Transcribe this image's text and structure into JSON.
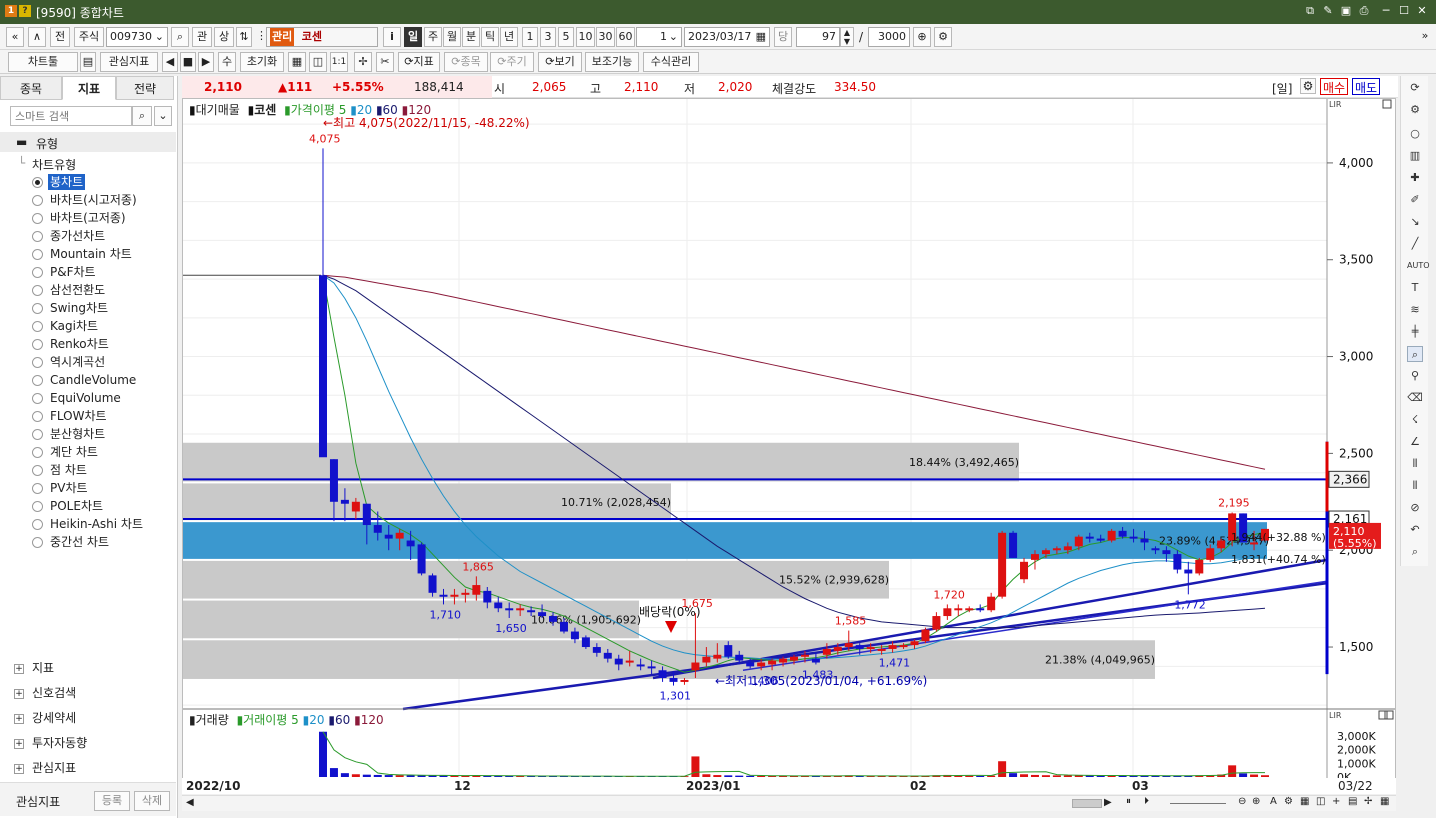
{
  "window": {
    "title": "[9590] 종합차트",
    "logo1": "1",
    "logo2": "?",
    "min": "─",
    "max": "☐",
    "close": "✕"
  },
  "toolbar1": {
    "nav_first": "«",
    "nav_prev": "∧",
    "prev_label": "전",
    "market": "주식",
    "code": "009730",
    "search_icon": "⌕",
    "lbl_gwan": "관",
    "lbl_sang": "상",
    "stock_badge": "관리",
    "stock_name": "코센",
    "info": "i",
    "periods": [
      "일",
      "주",
      "월",
      "분",
      "틱",
      "년"
    ],
    "period_selected": "일",
    "intervals": [
      "1",
      "3",
      "5",
      "10",
      "30",
      "60"
    ],
    "interval_value": "1",
    "date": "2023/03/17",
    "dang": "당",
    "count": "97",
    "slash": "/",
    "total": "3000"
  },
  "toolbar2": {
    "chart_tool": "차트툴",
    "fav_indicator": "관심지표",
    "su": "수",
    "reset": "초기화",
    "onetoone": "1:1",
    "indicator": "지표",
    "item": "종목",
    "cycle": "주기",
    "view": "보기",
    "aux": "보조기능",
    "formula": "수식관리"
  },
  "left_panel": {
    "tabs": [
      "종목",
      "지표",
      "전략"
    ],
    "selected_tab": "지표",
    "search_placeholder": "스마트 검색",
    "section": "유형",
    "group": "차트유형",
    "chart_types": [
      "봉차트",
      "바차트(시고저종)",
      "바차트(고저종)",
      "종가선차트",
      "Mountain 차트",
      "P&F차트",
      "삼선전환도",
      "Swing차트",
      "Kagi차트",
      "Renko차트",
      "역시계곡선",
      "CandleVolume",
      "EquiVolume",
      "FLOW차트",
      "분산형차트",
      "계단 차트",
      "점 차트",
      "PV차트",
      "POLE차트",
      "Heikin-Ashi 차트",
      "중간선 차트"
    ],
    "selected_type": "봉차트",
    "bottom_items": [
      "지표",
      "신호검색",
      "강세약세",
      "투자자동향",
      "관심지표"
    ],
    "footer_label": "관심지표",
    "register": "등록",
    "delete": "삭제"
  },
  "quote": {
    "price": "2,110",
    "change": "▲111",
    "change_pct": "+5.55%",
    "volume": "188,414",
    "open_label": "시",
    "open": "2,065",
    "high_label": "고",
    "high": "2,110",
    "low_label": "저",
    "low": "2,020",
    "strength_label": "체결강도",
    "strength": "334.50",
    "period_tag": "[일]",
    "buy": "매수",
    "sell": "매도"
  },
  "legend_main": {
    "vol_profile": "대기매물",
    "name": "코센",
    "ma_label": "가격이평",
    "ma": [
      "5",
      "20",
      "60",
      "120"
    ]
  },
  "legend_vol": {
    "title": "거래량",
    "ma_label": "거래이평",
    "ma": [
      "5",
      "20",
      "60",
      "120"
    ]
  },
  "annotations": {
    "high": "←최고 4,075(2022/11/15, -48.22%)",
    "low": "←최저 1,305(2023/01/04, +61.69%)",
    "dividend": "배당락(0%)"
  },
  "y_axis": {
    "ticks": [
      "4,000",
      "3,500",
      "3,000",
      "2,500",
      "2,000",
      "1,500"
    ],
    "marker_upper": "2,366",
    "marker_mid": "2,161",
    "marker_price": "2,110",
    "marker_pct": "(5.55%)"
  },
  "vol_axis": {
    "ticks": [
      "3,000K",
      "2,000K",
      "1,000K",
      "0K"
    ]
  },
  "x_axis": {
    "labels": [
      "2022/10",
      "12",
      "2023/01",
      "02",
      "03"
    ],
    "end": "03/22"
  },
  "chart_data": {
    "type": "candlestick",
    "title": "코센",
    "ylim": [
      1180,
      4330
    ],
    "candles": [
      [
        3420,
        4075,
        3420,
        2480
      ],
      [
        2470,
        2470,
        2150,
        2250
      ],
      [
        2260,
        2320,
        2150,
        2240
      ],
      [
        2200,
        2270,
        2160,
        2250
      ],
      [
        2240,
        2240,
        2030,
        2130
      ],
      [
        2130,
        2200,
        2050,
        2090
      ],
      [
        2080,
        2130,
        2000,
        2060
      ],
      [
        2060,
        2110,
        2000,
        2090
      ],
      [
        2050,
        2100,
        1950,
        2020
      ],
      [
        2030,
        2040,
        1870,
        1880
      ],
      [
        1870,
        1880,
        1760,
        1780
      ],
      [
        1770,
        1800,
        1720,
        1760
      ],
      [
        1760,
        1800,
        1720,
        1770
      ],
      [
        1770,
        1800,
        1730,
        1780
      ],
      [
        1770,
        1865,
        1740,
        1820
      ],
      [
        1790,
        1810,
        1700,
        1730
      ],
      [
        1730,
        1760,
        1680,
        1700
      ],
      [
        1700,
        1730,
        1650,
        1690
      ],
      [
        1690,
        1720,
        1660,
        1700
      ],
      [
        1690,
        1710,
        1660,
        1680
      ],
      [
        1680,
        1720,
        1650,
        1660
      ],
      [
        1660,
        1680,
        1610,
        1630
      ],
      [
        1630,
        1650,
        1570,
        1580
      ],
      [
        1580,
        1600,
        1520,
        1540
      ],
      [
        1550,
        1560,
        1490,
        1500
      ],
      [
        1500,
        1520,
        1450,
        1470
      ],
      [
        1470,
        1490,
        1420,
        1440
      ],
      [
        1440,
        1460,
        1380,
        1410
      ],
      [
        1420,
        1480,
        1400,
        1430
      ],
      [
        1410,
        1440,
        1380,
        1400
      ],
      [
        1400,
        1430,
        1360,
        1390
      ],
      [
        1380,
        1400,
        1320,
        1340
      ],
      [
        1340,
        1375,
        1301,
        1320
      ],
      [
        1320,
        1340,
        1305,
        1330
      ],
      [
        1380,
        1675,
        1340,
        1420
      ],
      [
        1420,
        1500,
        1400,
        1450
      ],
      [
        1440,
        1520,
        1420,
        1460
      ],
      [
        1510,
        1530,
        1440,
        1450
      ],
      [
        1460,
        1480,
        1410,
        1430
      ],
      [
        1420,
        1440,
        1390,
        1400
      ],
      [
        1400,
        1440,
        1380,
        1420
      ],
      [
        1410,
        1440,
        1380,
        1430
      ],
      [
        1420,
        1450,
        1400,
        1440
      ],
      [
        1430,
        1460,
        1410,
        1450
      ],
      [
        1450,
        1480,
        1420,
        1460
      ],
      [
        1440,
        1470,
        1410,
        1420
      ],
      [
        1460,
        1520,
        1440,
        1490
      ],
      [
        1480,
        1520,
        1460,
        1500
      ],
      [
        1500,
        1585,
        1480,
        1520
      ],
      [
        1510,
        1520,
        1460,
        1490
      ],
      [
        1490,
        1520,
        1470,
        1500
      ],
      [
        1480,
        1510,
        1460,
        1490
      ],
      [
        1490,
        1530,
        1471,
        1510
      ],
      [
        1500,
        1520,
        1490,
        1510
      ],
      [
        1510,
        1540,
        1490,
        1530
      ],
      [
        1530,
        1600,
        1520,
        1590
      ],
      [
        1590,
        1680,
        1580,
        1660
      ],
      [
        1660,
        1720,
        1640,
        1700
      ],
      [
        1690,
        1720,
        1660,
        1700
      ],
      [
        1690,
        1710,
        1680,
        1700
      ],
      [
        1700,
        1720,
        1680,
        1690
      ],
      [
        1690,
        1780,
        1680,
        1760
      ],
      [
        1760,
        2100,
        1750,
        2090
      ],
      [
        2090,
        2100,
        1960,
        1960
      ],
      [
        1850,
        1960,
        1830,
        1940
      ],
      [
        1950,
        2000,
        1900,
        1980
      ],
      [
        1980,
        2010,
        1960,
        2000
      ],
      [
        2000,
        2020,
        1980,
        2010
      ],
      [
        2000,
        2040,
        1980,
        2020
      ],
      [
        2020,
        2080,
        2000,
        2070
      ],
      [
        2070,
        2090,
        2040,
        2060
      ],
      [
        2060,
        2080,
        2040,
        2050
      ],
      [
        2050,
        2110,
        2040,
        2100
      ],
      [
        2100,
        2120,
        2060,
        2070
      ],
      [
        2070,
        2110,
        2040,
        2060
      ],
      [
        2060,
        2100,
        2000,
        2040
      ],
      [
        2010,
        2020,
        1980,
        2000
      ],
      [
        2000,
        2020,
        1940,
        1980
      ],
      [
        1980,
        2000,
        1880,
        1900
      ],
      [
        1900,
        1940,
        1772,
        1880
      ],
      [
        1880,
        1960,
        1870,
        1950
      ],
      [
        1950,
        2030,
        1940,
        2010
      ],
      [
        2010,
        2060,
        1990,
        2050
      ],
      [
        2050,
        2195,
        2020,
        2190
      ],
      [
        2190,
        2190,
        2040,
        2040
      ],
      [
        2030,
        2100,
        2000,
        2040
      ],
      [
        2050,
        2110,
        2040,
        2110
      ]
    ],
    "ma5": [
      3420,
      3100,
      2800,
      2450,
      2230,
      2180,
      2140,
      2110,
      2080,
      2040,
      1980,
      1920,
      1860,
      1810,
      1790,
      1780,
      1760,
      1740,
      1720,
      1705,
      1695,
      1680,
      1660,
      1630,
      1600,
      1570,
      1540,
      1510,
      1480,
      1455,
      1430,
      1410,
      1390,
      1370,
      1380,
      1395,
      1410,
      1430,
      1445,
      1440,
      1435,
      1430,
      1428,
      1430,
      1440,
      1445,
      1455,
      1470,
      1480,
      1490,
      1495,
      1500,
      1505,
      1510,
      1520,
      1545,
      1580,
      1620,
      1660,
      1690,
      1700,
      1720,
      1790,
      1850,
      1900,
      1940,
      1970,
      1980,
      1990,
      2010,
      2030,
      2040,
      2055,
      2065,
      2065,
      2060,
      2050,
      2030,
      2000,
      1970,
      1950,
      1960,
      1990,
      2040,
      2070,
      2080,
      2095
    ],
    "ma20": [
      3420,
      3380,
      3300,
      3200,
      3080,
      2950,
      2820,
      2700,
      2580,
      2470,
      2370,
      2280,
      2200,
      2130,
      2070,
      2020,
      1970,
      1930,
      1890,
      1860,
      1830,
      1800,
      1770,
      1740,
      1710,
      1680,
      1650,
      1620,
      1590,
      1560,
      1530,
      1505,
      1485,
      1470,
      1460,
      1455,
      1450,
      1448,
      1446,
      1444,
      1440,
      1438,
      1436,
      1436,
      1438,
      1440,
      1442,
      1446,
      1450,
      1455,
      1460,
      1466,
      1472,
      1480,
      1490,
      1505,
      1525,
      1545,
      1565,
      1585,
      1605,
      1625,
      1650,
      1680,
      1710,
      1740,
      1770,
      1800,
      1830,
      1855,
      1875,
      1895,
      1910,
      1925,
      1935,
      1940,
      1945,
      1945,
      1940,
      1935,
      1930,
      1930,
      1935,
      1945,
      1955,
      1960,
      1965
    ],
    "ma60": [
      3420,
      3400,
      3370,
      3340,
      3300,
      3260,
      3220,
      3180,
      3140,
      3100,
      3060,
      3020,
      2980,
      2940,
      2900,
      2860,
      2820,
      2780,
      2740,
      2700,
      2660,
      2620,
      2580,
      2540,
      2500,
      2460,
      2420,
      2380,
      2340,
      2300,
      2260,
      2220,
      2180,
      2140,
      2100,
      2060,
      2020,
      1985,
      1950,
      1915,
      1880,
      1845,
      1810,
      1780,
      1750,
      1725,
      1700,
      1680,
      1665,
      1650,
      1640,
      1630,
      1625,
      1620,
      1615,
      1610,
      1605,
      1600,
      1600,
      1600,
      1600,
      1600,
      1600,
      1600,
      1605,
      1610,
      1615,
      1620,
      1625,
      1630,
      1635,
      1640,
      1645,
      1650,
      1655,
      1660,
      1665,
      1668,
      1670,
      1673,
      1676,
      1680,
      1684,
      1688,
      1692,
      1696,
      1700
    ],
    "ma120": [
      3420,
      3415,
      3410,
      3400,
      3390,
      3380,
      3370,
      3360,
      3350,
      3340,
      3330,
      3318,
      3306,
      3294,
      3282,
      3270,
      3258,
      3246,
      3234,
      3222,
      3210,
      3198,
      3186,
      3174,
      3162,
      3150,
      3138,
      3126,
      3114,
      3102,
      3090,
      3078,
      3066,
      3054,
      3042,
      3030,
      3018,
      3006,
      2994,
      2982,
      2970,
      2958,
      2946,
      2934,
      2922,
      2910,
      2898,
      2886,
      2874,
      2862,
      2850,
      2838,
      2826,
      2814,
      2802,
      2790,
      2778,
      2766,
      2754,
      2742,
      2730,
      2718,
      2706,
      2694,
      2682,
      2670,
      2658,
      2646,
      2634,
      2622,
      2610,
      2598,
      2586,
      2574,
      2562,
      2550,
      2538,
      2526,
      2514,
      2502,
      2490,
      2478,
      2466,
      2454,
      2442,
      2430,
      2418
    ],
    "volume": [
      3300,
      650,
      280,
      200,
      170,
      150,
      140,
      130,
      120,
      110,
      110,
      100,
      95,
      100,
      130,
      90,
      80,
      75,
      80,
      70,
      70,
      70,
      65,
      60,
      60,
      60,
      55,
      55,
      55,
      50,
      50,
      50,
      55,
      60,
      1500,
      200,
      140,
      120,
      100,
      90,
      85,
      80,
      80,
      80,
      75,
      75,
      85,
      80,
      120,
      75,
      70,
      70,
      80,
      70,
      75,
      90,
      130,
      150,
      120,
      90,
      80,
      100,
      1150,
      280,
      200,
      150,
      130,
      120,
      110,
      120,
      110,
      100,
      110,
      100,
      95,
      90,
      85,
      85,
      95,
      110,
      120,
      140,
      180,
      850,
      260,
      180,
      130
    ],
    "vol_ylim": [
      0,
      3500
    ],
    "volume_profile": [
      {
        "range": [
          2350,
          2560
        ],
        "pct": "18.44%",
        "value": "3,492,465"
      },
      {
        "range": [
          2150,
          2350
        ],
        "pct": "10.71%",
        "value": "2,028,454"
      },
      {
        "range": [
          1950,
          2150
        ],
        "pct": "23.89%",
        "value": "4,524,937"
      },
      {
        "range": [
          1745,
          1950
        ],
        "pct": "15.52%",
        "value": "2,939,628"
      },
      {
        "range": [
          1540,
          1745
        ],
        "pct": "10.06%",
        "value": "1,905,692"
      },
      {
        "range": [
          1330,
          1540
        ],
        "pct": "21.38%",
        "value": "4,049,965"
      }
    ],
    "price_labels": [
      {
        "i": 0,
        "text": "4,075",
        "kind": "high"
      },
      {
        "i": 14,
        "text": "1,865",
        "kind": "high"
      },
      {
        "i": 11,
        "text": "1,710",
        "kind": "low"
      },
      {
        "i": 17,
        "text": "1,650",
        "kind": "low"
      },
      {
        "i": 34,
        "text": "1,675",
        "kind": "high"
      },
      {
        "i": 32,
        "text": "1,301",
        "kind": "low"
      },
      {
        "i": 48,
        "text": "1,585",
        "kind": "high"
      },
      {
        "i": 57,
        "text": "1,720",
        "kind": "high"
      },
      {
        "i": 52,
        "text": "1,471",
        "kind": "low"
      },
      {
        "i": 83,
        "text": "2,195",
        "kind": "high"
      },
      {
        "i": 79,
        "text": "1,772",
        "kind": "low"
      },
      {
        "i": 40,
        "text": "1,406",
        "kind": "low"
      },
      {
        "i": 45,
        "text": "1,483",
        "kind": "low"
      }
    ],
    "trend_labels": [
      "1,944(+32.88 %)",
      "1,831(+40.74 %)"
    ],
    "levels": {
      "upper": 2366,
      "mid": 2161
    }
  },
  "colors": {
    "up": "#dd1111",
    "down": "#1111cc",
    "ma5": "#2a9a2a",
    "ma20": "#1e90c8",
    "ma60": "#1a1a6e",
    "ma120": "#8b1a3a",
    "profile": "#c9c9c9",
    "profile_hl": "#3b98cf",
    "hline": "#0000cc"
  }
}
